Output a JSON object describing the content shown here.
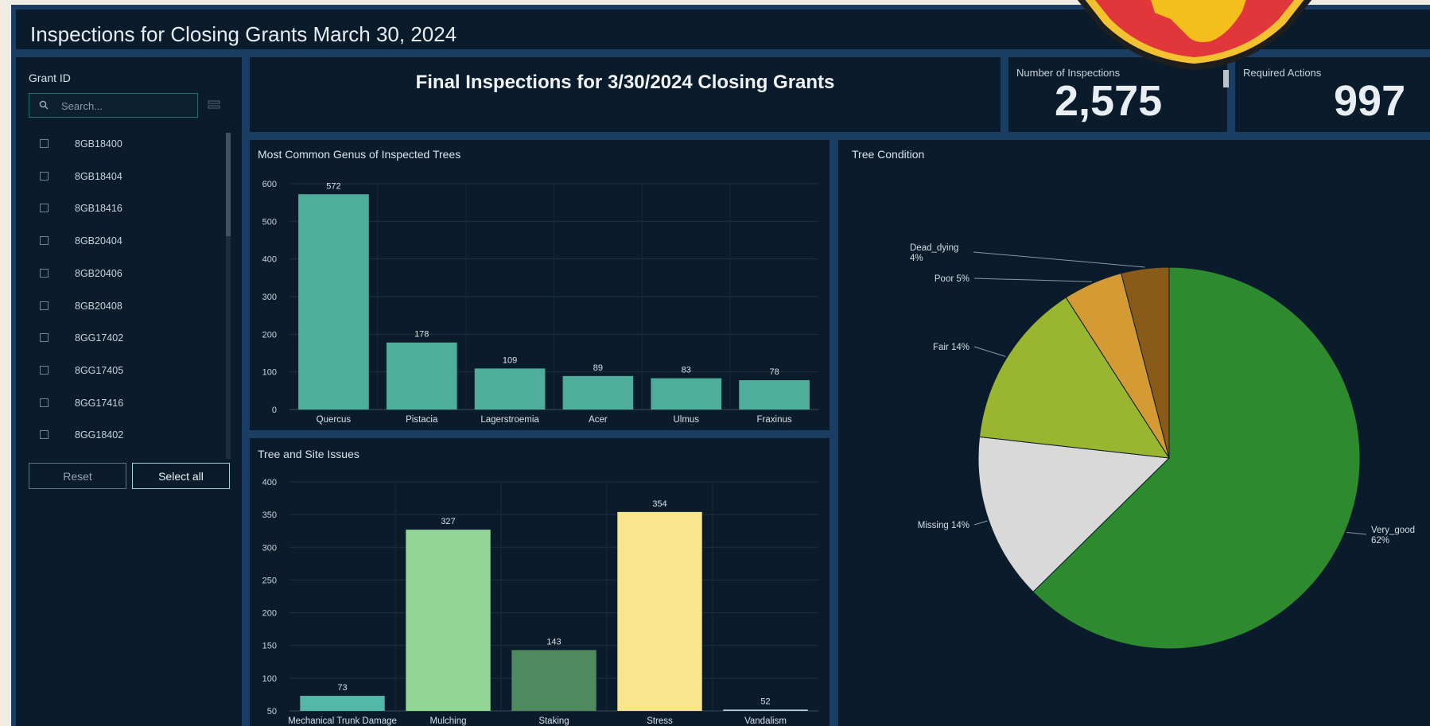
{
  "header": {
    "title": "Inspections for Closing Grants March 30, 2024"
  },
  "grant_filter": {
    "label": "Grant ID",
    "search_placeholder": "Search...",
    "items": [
      "8GB18400",
      "8GB18404",
      "8GB18416",
      "8GB20404",
      "8GB20406",
      "8GB20408",
      "8GG17402",
      "8GG17405",
      "8GG17416",
      "8GG18402"
    ],
    "reset_label": "Reset",
    "select_all_label": "Select all"
  },
  "title_panel": {
    "title": "Final Inspections for 3/30/2024 Closing Grants"
  },
  "kpis": {
    "inspections": {
      "label": "Number of Inspections",
      "value": "2,575"
    },
    "actions": {
      "label": "Required Actions",
      "value": "997"
    }
  },
  "colors": {
    "genus_bar": "#4fae9a",
    "issue_bars": [
      "#55b7a7",
      "#93d497",
      "#4f8a5e",
      "#f7e68e",
      "#b6d3e0"
    ],
    "pie": [
      "#2d8a2f",
      "#d9d9d9",
      "#9ab52f",
      "#d49a33",
      "#8a5a18"
    ]
  },
  "chart_data": [
    {
      "type": "bar",
      "title": "Most Common Genus of Inspected Trees",
      "categories": [
        "Quercus",
        "Pistacia",
        "Lagerstroemia",
        "Acer",
        "Ulmus",
        "Fraxinus"
      ],
      "values": [
        572,
        178,
        109,
        89,
        83,
        78
      ],
      "ylim": [
        0,
        600
      ],
      "yticks": [
        0,
        100,
        200,
        300,
        400,
        500,
        600
      ],
      "grid": true
    },
    {
      "type": "bar",
      "title": "Tree and Site Issues",
      "categories": [
        "Mechanical Trunk Damage",
        "Mulching",
        "Staking",
        "Stress",
        "Vandalism"
      ],
      "values": [
        73,
        327,
        143,
        354,
        52
      ],
      "ylim": [
        50,
        400
      ],
      "yticks": [
        50,
        100,
        150,
        200,
        250,
        300,
        350,
        400
      ],
      "grid": true
    },
    {
      "type": "pie",
      "title": "Tree Condition",
      "slices": [
        {
          "label": "Very_good",
          "value": 62,
          "text": [
            "Very_good",
            "62%"
          ]
        },
        {
          "label": "Missing",
          "value": 14,
          "text": [
            "Missing 14%"
          ]
        },
        {
          "label": "Fair",
          "value": 14,
          "text": [
            "Fair 14%"
          ]
        },
        {
          "label": "Poor",
          "value": 5,
          "text": [
            "Poor 5%"
          ]
        },
        {
          "label": "Dead_dying",
          "value": 4,
          "text": [
            "Dead_dying",
            "4%"
          ]
        }
      ]
    }
  ]
}
